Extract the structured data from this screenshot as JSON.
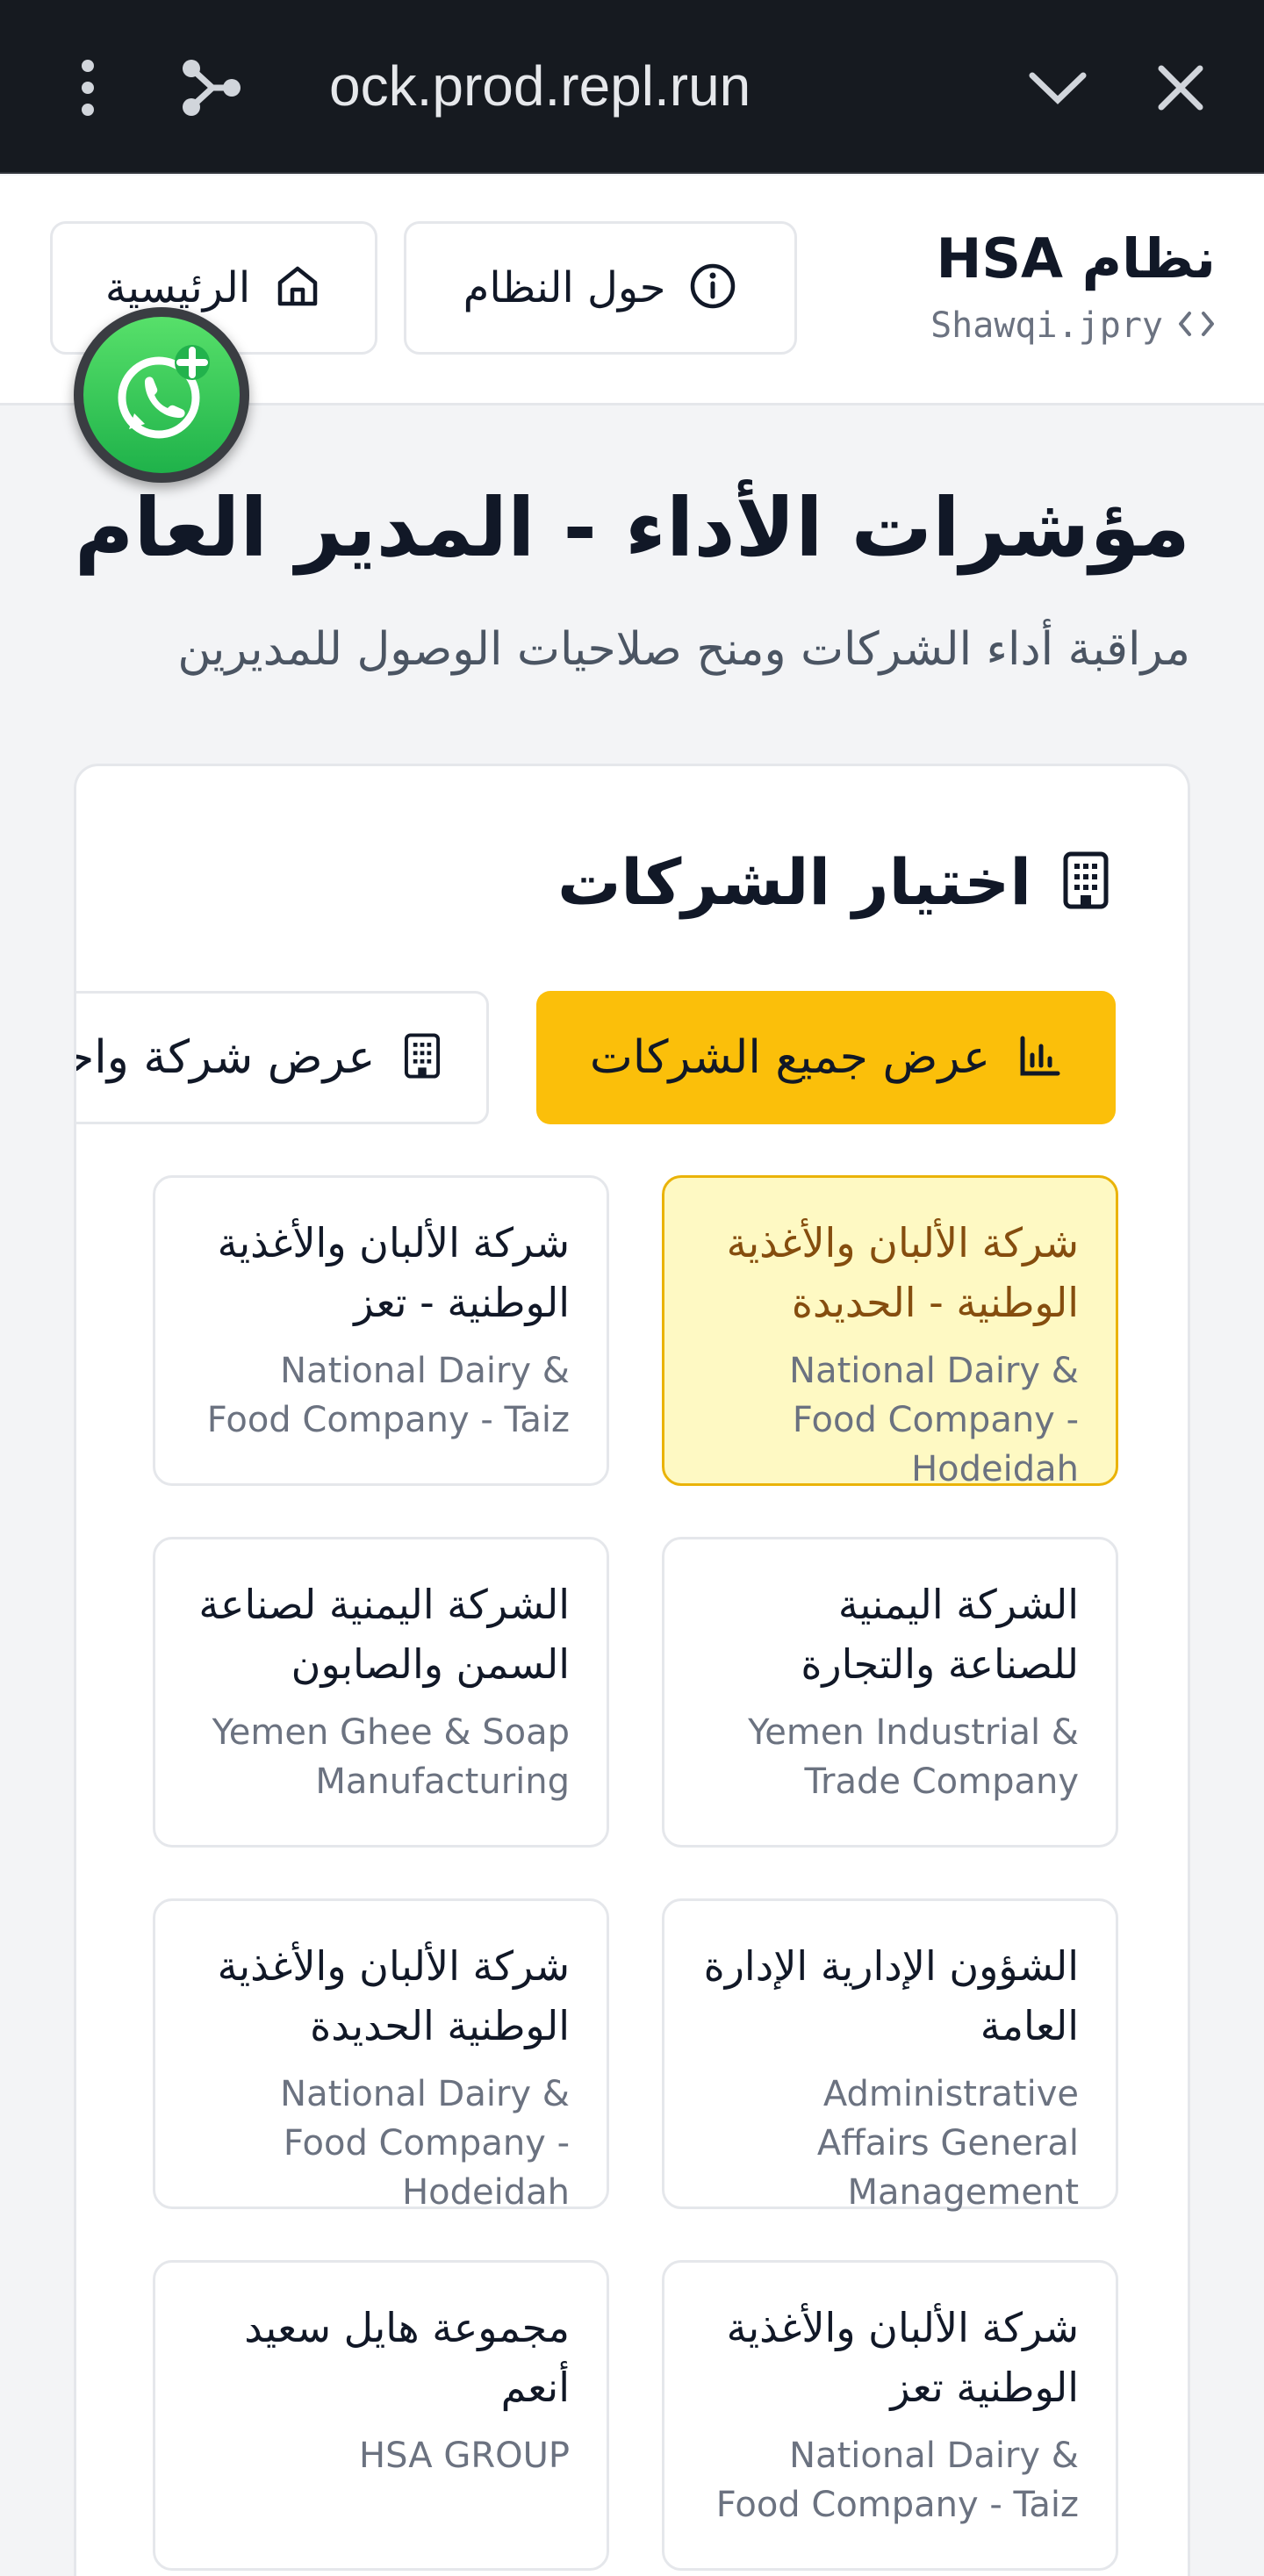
{
  "browser": {
    "url": "ock.prod.repl.run"
  },
  "header": {
    "brand_title": "نظام HSA",
    "brand_sub": "Shawqi.jpry",
    "about_label": "حول النظام",
    "home_label": "الرئيسية"
  },
  "page": {
    "title": "مؤشرات الأداء - المدير العام",
    "subtitle": "مراقبة أداء الشركات ومنح صلاحيات الوصول للمديرين"
  },
  "card": {
    "title": "اختيار الشركات",
    "show_all_label": "عرض جميع الشركات",
    "show_one_label": "عرض شركة واحدة"
  },
  "companies": [
    {
      "ar": "شركة الألبان والأغذية الوطنية - الحديدة",
      "en": "National Dairy & Food Company - Hodeidah",
      "selected": true
    },
    {
      "ar": "شركة الألبان والأغذية الوطنية - تعز",
      "en": "National Dairy & Food Company - Taiz",
      "selected": false
    },
    {
      "ar": "الشركة اليمنية للصناعة والتجارة",
      "en": "Yemen Industrial & Trade Company",
      "selected": false
    },
    {
      "ar": "الشركة اليمنية لصناعة السمن والصابون",
      "en": "Yemen Ghee & Soap Manufacturing",
      "selected": false
    },
    {
      "ar": "الشؤون الإدارية الإدارة العامة",
      "en": "Administrative Affairs General Management",
      "selected": false
    },
    {
      "ar": "شركة الألبان والأغذية الوطنية الحديدة",
      "en": "National Dairy & Food Company - Hodeidah",
      "selected": false
    },
    {
      "ar": "شركة الألبان والأغذية الوطنية تعز",
      "en": "National Dairy & Food Company - Taiz",
      "selected": false
    },
    {
      "ar": "مجموعة هايل سعيد أنعم",
      "en": "HSA GROUP",
      "selected": false
    }
  ],
  "colors": {
    "accent": "#fbbf0a",
    "selected_bg": "#fef9c3",
    "selected_border": "#eab308",
    "selected_text": "#854d0e",
    "whatsapp": "#25d366"
  },
  "icons": {
    "menu": "kebab-menu-icon",
    "share": "share-icon",
    "chevron": "chevron-down-icon",
    "close": "close-icon",
    "code": "code-icon",
    "info": "info-icon",
    "home": "home-icon",
    "building": "building-icon",
    "chart": "bar-chart-icon",
    "whatsapp": "whatsapp-icon"
  }
}
